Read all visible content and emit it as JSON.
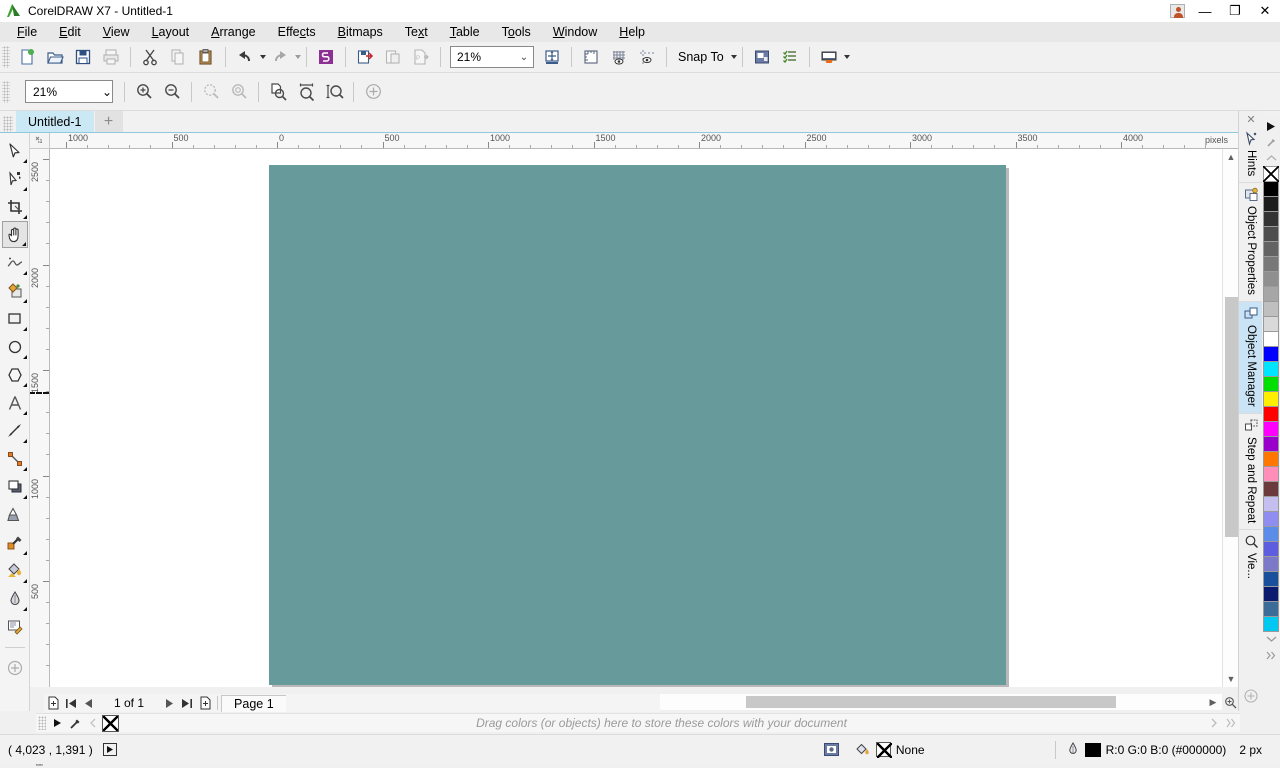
{
  "window": {
    "title": "CorelDRAW X7 - Untitled-1",
    "logo_icon": "coreldraw-logo-icon",
    "avatar_icon": "user-avatar-icon",
    "minimize_label": "—",
    "restore_label": "❐",
    "close_label": "✕"
  },
  "menubar": {
    "items": [
      {
        "label": "File",
        "accel": "F"
      },
      {
        "label": "Edit",
        "accel": "E"
      },
      {
        "label": "View",
        "accel": "V"
      },
      {
        "label": "Layout",
        "accel": "L"
      },
      {
        "label": "Arrange",
        "accel": "A"
      },
      {
        "label": "Effects",
        "accel": "c"
      },
      {
        "label": "Bitmaps",
        "accel": "B"
      },
      {
        "label": "Text",
        "accel": "x"
      },
      {
        "label": "Table",
        "accel": "T"
      },
      {
        "label": "Tools",
        "accel": "o"
      },
      {
        "label": "Window",
        "accel": "W"
      },
      {
        "label": "Help",
        "accel": "H"
      }
    ]
  },
  "toolbar_main": {
    "buttons": [
      {
        "name": "new-document-button",
        "icon": "new-document-icon",
        "enabled": true
      },
      {
        "name": "open-document-button",
        "icon": "folder-open-icon",
        "enabled": true
      },
      {
        "name": "save-document-button",
        "icon": "floppy-save-icon",
        "enabled": true
      },
      {
        "name": "print-button",
        "icon": "printer-icon",
        "enabled": false
      },
      {
        "name": "cut-button",
        "icon": "scissors-icon",
        "enabled": true
      },
      {
        "name": "copy-button",
        "icon": "copy-icon",
        "enabled": false
      },
      {
        "name": "paste-button",
        "icon": "clipboard-paste-icon",
        "enabled": true
      },
      {
        "name": "undo-button",
        "icon": "undo-arrow-icon",
        "enabled": true
      },
      {
        "name": "redo-button",
        "icon": "redo-arrow-icon",
        "enabled": false
      },
      {
        "name": "search-content-button",
        "icon": "corel-connect-icon",
        "enabled": true
      },
      {
        "name": "import-button",
        "icon": "import-icon",
        "enabled": true
      },
      {
        "name": "export-button",
        "icon": "export-icon",
        "enabled": false
      },
      {
        "name": "publish-pdf-button",
        "icon": "pdf-export-icon",
        "enabled": false
      }
    ],
    "zoom_level": "21%",
    "zoom_chevron_icon": "chevron-down-icon",
    "fullscreen_icon": "full-screen-preview-icon",
    "ruler_icon": "show-rulers-icon",
    "grid_icon": "show-grid-icon",
    "guides_icon": "show-guidelines-icon",
    "snap_to_label": "Snap To",
    "snap_caret_icon": "chevron-down-icon",
    "options_icon": "options-dialog-icon",
    "object_styles_icon": "object-styles-icon",
    "app_launcher_icon": "application-launcher-icon",
    "app_launcher_caret_icon": "chevron-down-icon"
  },
  "toolbar_zoom": {
    "zoom_level": "21%",
    "zoom_chevron_icon": "chevron-down-icon",
    "buttons": [
      {
        "name": "zoom-in-button",
        "icon": "zoom-in-icon",
        "enabled": true
      },
      {
        "name": "zoom-out-button",
        "icon": "zoom-out-icon",
        "enabled": true
      },
      {
        "name": "zoom-to-selected-button",
        "icon": "zoom-to-selection-icon",
        "enabled": false
      },
      {
        "name": "zoom-to-all-objects-button",
        "icon": "zoom-to-objects-icon",
        "enabled": false
      },
      {
        "name": "zoom-to-page-button",
        "icon": "zoom-to-page-icon",
        "enabled": true
      },
      {
        "name": "zoom-to-page-width-button",
        "icon": "zoom-page-width-icon",
        "enabled": true
      },
      {
        "name": "zoom-to-page-height-button",
        "icon": "zoom-page-height-icon",
        "enabled": true
      },
      {
        "name": "customize-toolbar-button",
        "icon": "plus-circle-icon",
        "enabled": true
      }
    ]
  },
  "tabbar": {
    "documents": [
      {
        "label": "Untitled-1",
        "active": true
      }
    ],
    "add_tab_label": "+"
  },
  "toolbox": {
    "tools": [
      {
        "name": "pick-tool",
        "icon": "arrow-cursor-icon",
        "active": false,
        "flyout": true
      },
      {
        "name": "shape-tool",
        "icon": "shape-node-edit-icon",
        "active": false,
        "flyout": true
      },
      {
        "name": "crop-tool",
        "icon": "crop-icon",
        "active": false,
        "flyout": true
      },
      {
        "name": "pan-tool",
        "icon": "hand-pan-icon",
        "active": true,
        "flyout": true
      },
      {
        "name": "freehand-tool",
        "icon": "freehand-curve-icon",
        "active": false,
        "flyout": true
      },
      {
        "name": "smart-fill-tool",
        "icon": "smart-fill-icon",
        "active": false,
        "flyout": true
      },
      {
        "name": "rectangle-tool",
        "icon": "rectangle-icon",
        "active": false,
        "flyout": true
      },
      {
        "name": "ellipse-tool",
        "icon": "ellipse-icon",
        "active": false,
        "flyout": true
      },
      {
        "name": "polygon-tool",
        "icon": "polygon-icon",
        "active": false,
        "flyout": true
      },
      {
        "name": "text-tool",
        "icon": "text-a-icon",
        "active": false,
        "flyout": true
      },
      {
        "name": "dimension-tool",
        "icon": "dimension-line-icon",
        "active": false,
        "flyout": true
      },
      {
        "name": "connector-tool",
        "icon": "connector-line-icon",
        "active": false,
        "flyout": true
      },
      {
        "name": "drop-shadow-tool",
        "icon": "drop-shadow-icon",
        "active": false,
        "flyout": true
      },
      {
        "name": "transparency-tool",
        "icon": "transparency-icon",
        "active": false,
        "flyout": false
      },
      {
        "name": "color-eyedropper-tool",
        "icon": "eyedropper-icon",
        "active": false,
        "flyout": true
      },
      {
        "name": "fill-tool",
        "icon": "paint-bucket-fill-icon",
        "active": false,
        "flyout": true
      },
      {
        "name": "interactive-fill-tool",
        "icon": "interactive-fill-icon",
        "active": false,
        "flyout": true
      },
      {
        "name": "outline-tool",
        "icon": "outline-pen-icon",
        "active": false,
        "flyout": false
      },
      {
        "name": "customize-toolbox-button",
        "icon": "plus-circle-icon",
        "active": false,
        "flyout": false
      }
    ]
  },
  "rulers": {
    "unit": "pixels",
    "horizontal_labels": [
      "1000",
      "500",
      "0",
      "500",
      "1000",
      "1500",
      "2000",
      "2500",
      "3000",
      "3500",
      "4000"
    ],
    "vertical_labels": [
      "2500",
      "2000",
      "1500",
      "1000",
      "500"
    ],
    "origin_icon": "ruler-origin-icon"
  },
  "canvas": {
    "page_fill_color": "#679a9a",
    "page_shadow_color": "#b9b9b9",
    "background_color": "#ffffff"
  },
  "scrollbars": {
    "up_icon": "chevron-up-icon",
    "down_icon": "chevron-down-icon",
    "left_icon": "chevron-left-icon",
    "right_icon": "chevron-right-icon",
    "zoom_icon": "zoom-navigator-icon"
  },
  "dockers": {
    "close_icon": "close-icon",
    "collapse_icon": "chevron-right-icon",
    "tabs": [
      {
        "label": "Hints",
        "icon": "hints-pointer-icon",
        "active": false
      },
      {
        "label": "Object Properties",
        "icon": "object-properties-icon",
        "active": false
      },
      {
        "label": "Object Manager",
        "icon": "object-manager-icon",
        "active": true
      },
      {
        "label": "Step and Repeat",
        "icon": "step-and-repeat-icon",
        "active": false
      },
      {
        "label": "Vie...",
        "icon": "view-manager-magnifier-icon",
        "active": false
      }
    ],
    "add_docker_icon": "plus-circle-icon"
  },
  "palette": {
    "scroll_up_icon": "palette-arrow-up-icon",
    "eyedropper_icon": "palette-eyedropper-icon",
    "chevron_up_icon": "chevron-up-icon",
    "scroll_down_icon": "chevron-down-icon",
    "expand_icon": "double-chevron-icon",
    "none_label": "None",
    "colors": [
      "#000000",
      "#1c1c1c",
      "#333333",
      "#4d4d4d",
      "#636363",
      "#787878",
      "#8f8f8f",
      "#a6a6a6",
      "#bfbfbf",
      "#d9d9d9",
      "#ffffff",
      "#0000ff",
      "#00e5ff",
      "#00e000",
      "#ffee00",
      "#ff0000",
      "#ff00ff",
      "#9900cc",
      "#ff7700",
      "#ff8fb8",
      "#6b3a3a",
      "#c3c0f0",
      "#8f8ef0",
      "#5b8de8",
      "#5d5de0",
      "#7b79c8",
      "#1a4f9c",
      "#0a1a6e",
      "#3b6b99",
      "#00c8f0"
    ]
  },
  "pagenav": {
    "add_page_start_icon": "add-page-before-icon",
    "first_icon": "first-page-icon",
    "prev_icon": "previous-page-icon",
    "counter": "1 of 1",
    "next_icon": "next-page-icon",
    "last_icon": "last-page-icon",
    "add_page_end_icon": "add-page-after-icon",
    "page_tab_label": "Page 1"
  },
  "document_palette": {
    "expand_icon": "palette-arrow-icon",
    "eyedropper_icon": "eyedropper-icon",
    "prev_icon": "chevron-left-icon",
    "none_swatch_label": "None",
    "message": "Drag colors (or objects) here to store these colors with your document",
    "next_icon": "chevron-right-icon",
    "more_icon": "double-chevron-right-icon"
  },
  "statusbar": {
    "coordinates": "( 4,023 , 1,391 )",
    "coord_toggle_icon": "expand-status-icon",
    "snap_state_icon": "snap-display-icon",
    "fill_icon": "fill-color-icon",
    "fill_value": "None",
    "outline_icon": "outline-pen-icon",
    "outline_color": "#000000",
    "outline_value": "R:0 G:0 B:0 (#000000)",
    "outline_width": "2 px"
  }
}
